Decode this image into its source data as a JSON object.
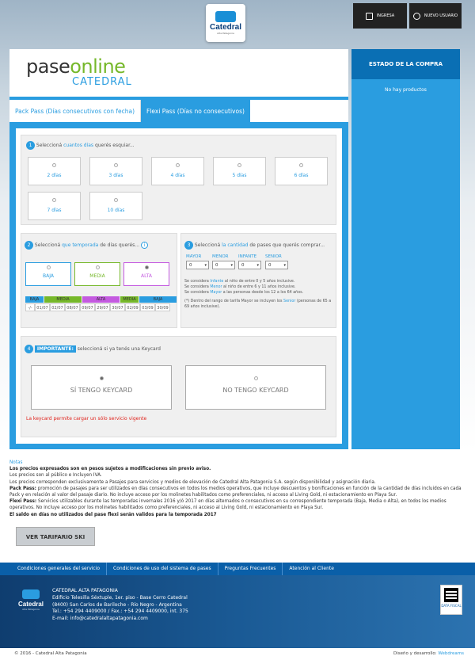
{
  "header": {
    "logo_name": "Catedral",
    "logo_sub": "Alta Patagonia",
    "login": "INGRESA",
    "new_user": "NUEVO USUARIO"
  },
  "brand": {
    "pase": "pase",
    "online": "online",
    "catedral": "CATEDRAL"
  },
  "tabs": [
    "Pack Pass (Días consecutivos con fecha)",
    "Flexi Pass (Días no consecutivos)"
  ],
  "step1": {
    "num": "1",
    "pre": "Seleccioná ",
    "hl": "cuantos días",
    "post": " querés esquiar...",
    "options": [
      "2 días",
      "3 días",
      "4 días",
      "5 días",
      "6 días",
      "7 días",
      "10 días"
    ]
  },
  "step2": {
    "num": "2",
    "pre": "Seleccioná ",
    "hl": "que temporada",
    "post": " de días querés...",
    "seasons": [
      "BAJA",
      "MEDIA",
      "ALTA"
    ],
    "legend": [
      "BAJA",
      "MEDIA",
      "ALTA",
      "MEDIA",
      "BAJA"
    ],
    "dates": [
      "-/-",
      "01/07",
      "02/07",
      "08/07",
      "09/07",
      "29/07",
      "30/07",
      "02/09",
      "03/09",
      "30/09"
    ]
  },
  "step3": {
    "num": "3",
    "pre": "Seleccioná ",
    "hl": "la cantidad",
    "post": " de pases que querés comprar...",
    "ages": [
      "MAYOR",
      "MENOR",
      "INFANTE",
      "SENIOR"
    ],
    "values": [
      "0",
      "0",
      "0",
      "0"
    ],
    "info1a": "Se considera ",
    "info1b": "Infante",
    "info1c": " al niño de entre 0 y 5 años inclusive.",
    "info2a": "Se considera ",
    "info2b": "Menor",
    "info2c": " al niño de entre 6 y 11 años inclusive.",
    "info3a": "Se considera ",
    "info3b": "Mayor",
    "info3c": " a las personas desde los 12 a los 64 años.",
    "info4a": "(*) Dentro del rango de tarifa Mayor se incluyen los ",
    "info4b": "Senior",
    "info4c": " (personas de 65 a 69 años inclusive)."
  },
  "step4": {
    "num": "4",
    "label": "IMPORTANTE:",
    "text": "seleccioná si ya tenés una Keycard",
    "yes": "SÍ TENGO KEYCARD",
    "no": "NO TENGO KEYCARD",
    "warning": "La keycard permite cargar un sólo servicio vigente"
  },
  "side": {
    "title": "ESTADO DE LA COMPRA",
    "empty": "No hay productos"
  },
  "notes": {
    "title": "Notas",
    "l1": "Los precios expresados son en pesos sujetos a modificaciones sin previo aviso.",
    "l2": "Los precios son al público e Incluyen IVA.",
    "l3": "Los precios corresponden exclusivamente a Pasajes para servicios y medios de elevación de Catedral Alta Patagonia S.A. según disponibilidad y asignación diaria.",
    "pack_label": "Pack Pass:",
    "pack": " promoción de pasajes para ser utilizados en días consecutivos en todos los medios operativos, que incluye descuentos y bonificaciones en función de la cantidad de días incluidos en cada Pack y en relación al valor del pasaje diario. No incluye acceso por los molinetes habilitados como preferenciales, ni acceso al Living Gold, ni estacionamiento en Playa Sur.",
    "flexi_label": "Flexi Pass:",
    "flexi": " Servicios utilizables durante las temporadas invernales 2016 y/ó 2017 en días alternados o consecutivos en su correspondiente temporada (Baja, Media o Alta), en todos los medios operativos. No incluye acceso por los molinetes habilitados como preferenciales, ni acceso al Living Gold, ni estacionamiento en Playa Sur.",
    "saldo": "El saldo en días no utilizados del pase flexi serán validos para la temporada 2017"
  },
  "tarifario": "VER TARIFARIO SKI",
  "footnav": [
    "Condiciones generales del servicio",
    "Condiciones de uso del sistema de pases",
    "Preguntas Frecuentes",
    "Atención al Cliente"
  ],
  "footer": {
    "company": "CATEDRAL ALTA PATAGONIA",
    "addr1": "Edificio Telesilla Séxtuple, 1er. piso - Base Cerro Catedral",
    "addr2": "(8400) San Carlos de Bariloche - Río Negro - Argentina",
    "tel": "Tel.: +54 294 4409000 / Fax.: +54 294 4409000, int. 375",
    "email": "E-mail: info@catedralaltapatagonia.com",
    "data_fiscal": "DATA FISCAL",
    "copyright": "© 2016 - Catedral Alta Patagonia",
    "design": "Diseño y desarrollo: ",
    "designer": "Webdreams"
  },
  "colors": {
    "accent": "#2a9de0",
    "dark": "#0a6fb4",
    "green": "#76b82a"
  }
}
